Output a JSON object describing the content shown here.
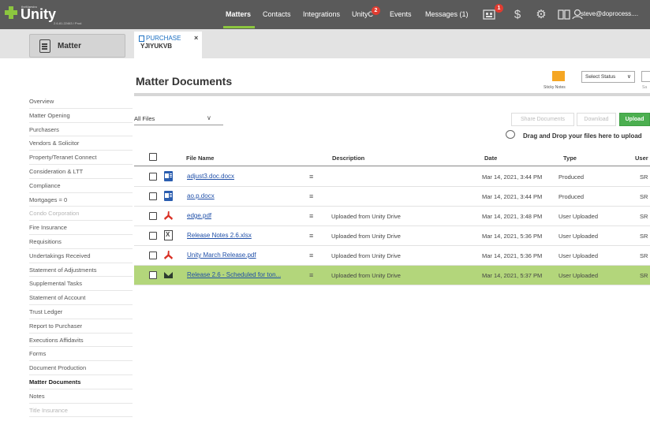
{
  "app": {
    "brand_small": "theMaestro",
    "name": "Unity",
    "version": "2.6-81.22463 / Prod"
  },
  "nav": {
    "items": [
      {
        "label": "Matters",
        "active": true
      },
      {
        "label": "Contacts"
      },
      {
        "label": "Integrations"
      },
      {
        "label": "UnityC",
        "badge": "2"
      },
      {
        "label": "Events"
      },
      {
        "label": "Messages (1)"
      }
    ],
    "icons": [
      {
        "name": "notifications-icon",
        "badge": "1"
      },
      {
        "name": "dollar-icon"
      },
      {
        "name": "gear-icon"
      },
      {
        "name": "book-icon"
      },
      {
        "name": "user-icon"
      }
    ],
    "user": "steve@doprocess...."
  },
  "subbar": {
    "matter_label": "Matter",
    "tab_type": "PURCHASE",
    "tab_number": "YJIYUKVB",
    "tab_close": "×"
  },
  "page": {
    "title": "Matter Documents",
    "sticky_notes": "Sticky Notes",
    "select_status": "Select Status",
    "save_label": "Sa"
  },
  "sidebar": {
    "items": [
      {
        "label": "Overview"
      },
      {
        "label": "Matter Opening"
      },
      {
        "label": "Purchasers"
      },
      {
        "label": "Vendors & Solicitor"
      },
      {
        "label": "Property/Teranet Connect"
      },
      {
        "label": "Consideration & LTT"
      },
      {
        "label": "Compliance"
      },
      {
        "label": "Mortgages = 0"
      },
      {
        "label": "Condo Corporation",
        "disabled": true
      },
      {
        "label": "Fire Insurance"
      },
      {
        "label": "Requisitions"
      },
      {
        "label": "Undertakings Received"
      },
      {
        "label": "Statement of Adjustments"
      },
      {
        "label": "Supplemental Tasks"
      },
      {
        "label": "Statement of Account"
      },
      {
        "label": "Trust Ledger"
      },
      {
        "label": "Report to Purchaser"
      },
      {
        "label": "Executions Affidavits"
      },
      {
        "label": "Forms"
      },
      {
        "label": "Document Production"
      },
      {
        "label": "Matter Documents",
        "active": true
      },
      {
        "label": "Notes"
      },
      {
        "label": "Title Insurance",
        "disabled": true
      }
    ]
  },
  "toolbar": {
    "filter_value": "All Files",
    "share_label": "Share Documents",
    "download_label": "Download",
    "upload_label": "Upload",
    "drag_text": "Drag and Drop your files here to upload"
  },
  "table": {
    "headers": {
      "file_name": "File Name",
      "description": "Description",
      "date": "Date",
      "type": "Type",
      "user": "User"
    },
    "rows": [
      {
        "icon": "word",
        "icon_name": "word-file-icon",
        "name": "adjust3.doc.docx",
        "description": "",
        "date": "Mar 14, 2021, 3:44 PM",
        "type": "Produced",
        "user": "SR"
      },
      {
        "icon": "word",
        "icon_name": "word-file-icon",
        "name": "ao.p.docx",
        "description": "",
        "date": "Mar 14, 2021, 3:44 PM",
        "type": "Produced",
        "user": "SR"
      },
      {
        "icon": "pdf",
        "icon_name": "pdf-file-icon",
        "name": "edge.pdf",
        "description": "Uploaded from Unity Drive",
        "date": "Mar 14, 2021, 3:48 PM",
        "type": "User Uploaded",
        "user": "SR"
      },
      {
        "icon": "xls",
        "icon_name": "excel-file-icon",
        "name": "Release Notes 2.6.xlsx",
        "description": "Uploaded from Unity Drive",
        "date": "Mar 14, 2021, 5:36 PM",
        "type": "User Uploaded",
        "user": "SR"
      },
      {
        "icon": "pdf",
        "icon_name": "pdf-file-icon",
        "name": "Unity March Release.pdf",
        "description": "Uploaded from Unity Drive",
        "date": "Mar 14, 2021, 5:36 PM",
        "type": "User Uploaded",
        "user": "SR"
      },
      {
        "icon": "mail",
        "icon_name": "email-file-icon",
        "name": "Release 2.6 - Scheduled for ton...",
        "description": "Uploaded from Unity Drive",
        "date": "Mar 14, 2021, 5:37 PM",
        "type": "User Uploaded",
        "user": "SR",
        "highlighted": true
      }
    ]
  },
  "colors": {
    "topbar": "#5a5a5a",
    "accent_green": "#8cc63f",
    "upload_green": "#4caf50",
    "highlight_row": "#b3d67b",
    "badge_red": "#e03c31",
    "link_blue": "#1f4fa8"
  }
}
